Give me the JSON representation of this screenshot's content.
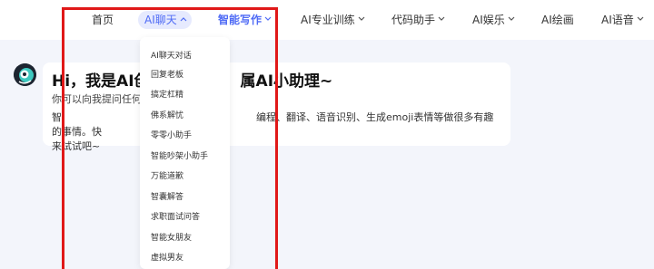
{
  "nav": {
    "items": [
      {
        "label": "首页"
      },
      {
        "label": "AI聊天"
      },
      {
        "label": "智能写作"
      },
      {
        "label": "AI专业训练"
      },
      {
        "label": "代码助手"
      },
      {
        "label": "AI娱乐"
      },
      {
        "label": "AI绘画"
      },
      {
        "label": "AI语音"
      }
    ],
    "active_index": 2,
    "accent_color": "#4f6bf5"
  },
  "welcome": {
    "title_left": "Hi，我是AI创",
    "title_right": "属AI小助理~",
    "subtitle": "你可以向我提问任何问",
    "body_left": "智",
    "body_right": "编程、翻译、语音识别、生成emoji表情等做很多有趣的事情。快",
    "body_line2": "来试试吧~"
  },
  "dropdown": {
    "items": [
      "AI聊天对话",
      "回复老板",
      "搞定杠精",
      "佛系解忧",
      "零零小助手",
      "智能吵架小助手",
      "万能道歉",
      "智囊解答",
      "求职面试问答",
      "智能女朋友",
      "虚拟男友"
    ]
  },
  "highlight_color": "#e01818"
}
